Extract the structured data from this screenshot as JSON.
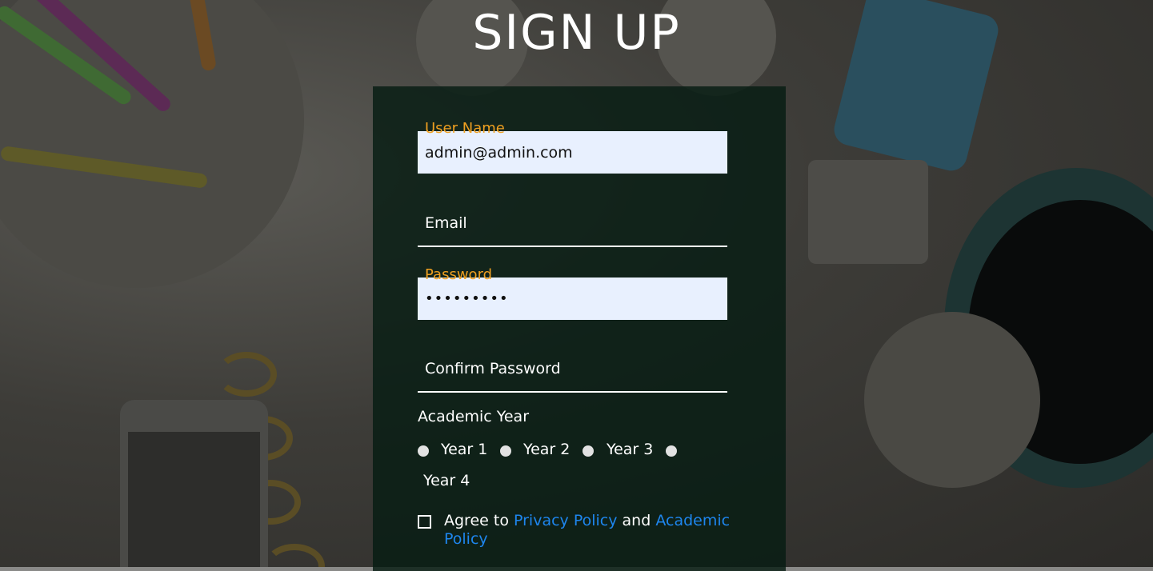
{
  "page": {
    "title": "SIGN UP"
  },
  "form": {
    "username": {
      "label": "User Name",
      "value": "admin@admin.com"
    },
    "email": {
      "placeholder": "Email"
    },
    "password": {
      "label": "Password",
      "value": "•••••••••"
    },
    "confirm_password": {
      "placeholder": "Confirm Password"
    },
    "academic_year": {
      "label": "Academic Year",
      "options": [
        "Year 1",
        "Year 2",
        "Year 3",
        "Year 4"
      ]
    },
    "agree": {
      "prefix": "Agree to",
      "privacy_link": "Privacy Policy",
      "conjunction": "and",
      "academic_link_1": "Academic",
      "academic_link_2": "Policy",
      "checked": false
    }
  },
  "colors": {
    "floating_label": "#f0a020",
    "link": "#1e86ee",
    "input_fill": "#e8f0fe",
    "panel": "#061c12"
  }
}
